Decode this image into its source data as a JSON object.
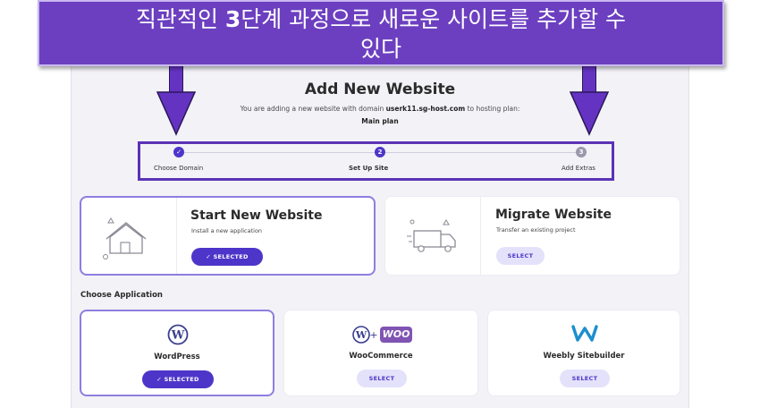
{
  "banner": {
    "line1_pre": "직관적인 ",
    "line1_num": "3",
    "line1_post": "단계 과정으로 새로운 사이트를 추가할 수",
    "line2": "있다"
  },
  "header": {
    "title": "Add New Website",
    "subtitle_pre": "You are adding a new website with domain ",
    "domain": "userk11.sg-host.com",
    "subtitle_post": " to hosting plan:",
    "plan": "Main plan"
  },
  "steps": [
    {
      "label": "Choose Domain",
      "marker": "✓",
      "state": "done"
    },
    {
      "label": "Set Up Site",
      "marker": "2",
      "state": "current"
    },
    {
      "label": "Add Extras",
      "marker": "3",
      "state": "pending"
    }
  ],
  "options": {
    "start": {
      "title": "Start New Website",
      "desc": "Install a new application",
      "button": "✓ SELECTED"
    },
    "migrate": {
      "title": "Migrate Website",
      "desc": "Transfer an existing project",
      "button": "SELECT"
    }
  },
  "apps_heading": "Choose Application",
  "apps": [
    {
      "name": "WordPress",
      "button": "✓ SELECTED",
      "icon": "wordpress-logo"
    },
    {
      "name": "WooCommerce",
      "button": "SELECT",
      "icon": "woocommerce-logo",
      "woo_text": "WOO"
    },
    {
      "name": "Weebly Sitebuilder",
      "button": "SELECT",
      "icon": "weebly-logo"
    }
  ],
  "colors": {
    "accent": "#4e35c9",
    "banner": "#6c3fc0",
    "arrow": "#6533c2"
  }
}
